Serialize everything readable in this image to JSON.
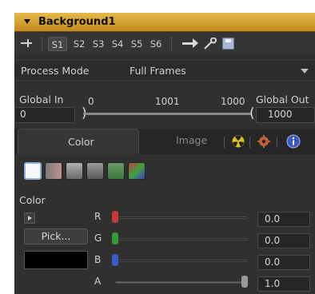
{
  "header": {
    "title": "Background1"
  },
  "toolbar": {
    "slots": [
      "S1",
      "S2",
      "S3",
      "S4",
      "S5",
      "S6"
    ],
    "active_slot": "S1"
  },
  "process_mode": {
    "label": "Process Mode",
    "value": "Full Frames"
  },
  "range": {
    "global_in_label": "Global In",
    "global_out_label": "Global Out",
    "global_in_value": "0",
    "global_out_value": "1000",
    "tick_start": "0",
    "tick_mid": "1001",
    "tick_end": "1000"
  },
  "tabs": {
    "color": "Color",
    "image": "Image"
  },
  "color_section": {
    "label": "Color",
    "pick_label": "Pick...",
    "channels": [
      {
        "name": "R",
        "value": "0.0",
        "level": 0.0,
        "color": "#c83a3a"
      },
      {
        "name": "G",
        "value": "0.0",
        "level": 0.0,
        "color": "#3a9a3a"
      },
      {
        "name": "B",
        "value": "0.0",
        "level": 0.0,
        "color": "#3a5ac8"
      },
      {
        "name": "A",
        "value": "1.0",
        "level": 1.0,
        "color": "#9a9a9a"
      }
    ],
    "swatch_color": "#000000"
  },
  "colors": {
    "header_accent": "#d4a232",
    "panel_bg": "#303030"
  }
}
